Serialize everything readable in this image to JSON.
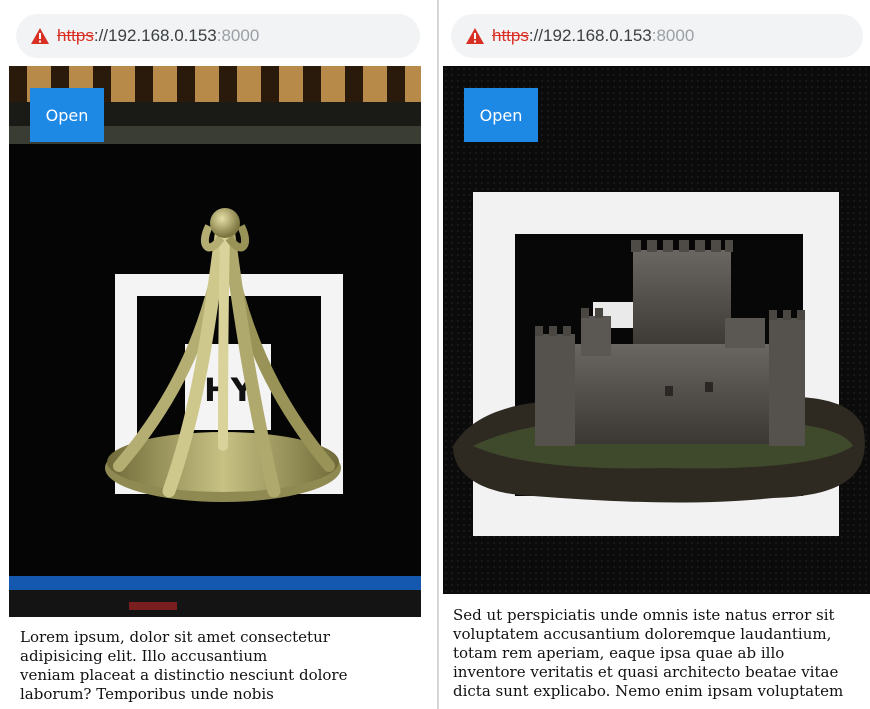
{
  "left": {
    "url": {
      "scheme": "https",
      "host": "://192.168.0.153",
      "port": ":8000"
    },
    "open_button": "Open",
    "marker_letters": "HY",
    "caption_lines": [
      "Lorem ipsum, dolor sit amet consectetur",
      "adipisicing elit. Illo accusantium",
      "veniam placeat a distinctio nesciunt dolore",
      "laborum? Temporibus unde nobis"
    ]
  },
  "right": {
    "url": {
      "scheme": "https",
      "host": "://192.168.0.153",
      "port": ":8000"
    },
    "open_button": "Open",
    "caption_lines": [
      "Sed ut perspiciatis unde omnis iste natus error sit",
      "voluptatem accusantium doloremque laudantium,",
      "totam rem aperiam, eaque ipsa quae ab illo",
      "inventore veritatis et quasi architecto beatae vitae",
      "dicta sunt explicabo. Nemo enim ipsam voluptatem"
    ]
  },
  "colors": {
    "accent": "#1e88e5",
    "warning": "#d93025",
    "address_bg": "#f1f3f4",
    "model_gold": "#a39c62"
  }
}
